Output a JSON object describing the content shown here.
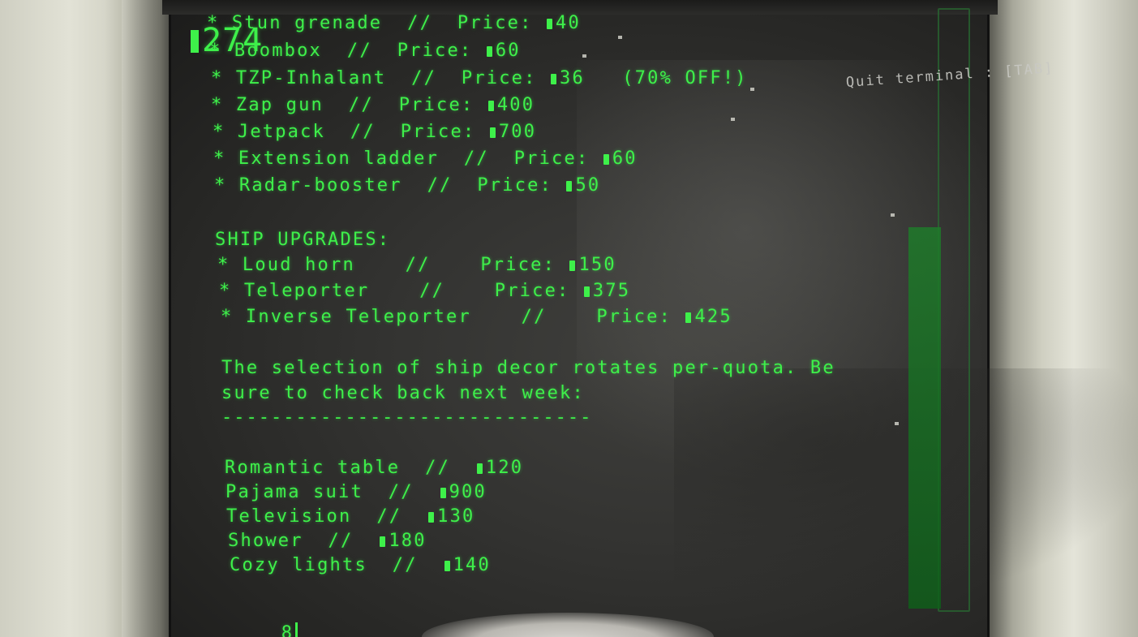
{
  "credits": "274",
  "quit_hint": "Quit terminal : [TAB]",
  "items": [
    {
      "name": "Stun grenade",
      "price": "40",
      "note": ""
    },
    {
      "name": "Boombox",
      "price": "60",
      "note": ""
    },
    {
      "name": "TZP-Inhalant",
      "price": "36",
      "note": "(70% OFF!)"
    },
    {
      "name": "Zap gun",
      "price": "400",
      "note": ""
    },
    {
      "name": "Jetpack",
      "price": "700",
      "note": ""
    },
    {
      "name": "Extension ladder",
      "price": "60",
      "note": ""
    },
    {
      "name": "Radar-booster",
      "price": "50",
      "note": ""
    }
  ],
  "upgrades_heading": "SHIP UPGRADES:",
  "upgrades": [
    {
      "name": "Loud horn",
      "price": "150"
    },
    {
      "name": "Teleporter",
      "price": "375"
    },
    {
      "name": "Inverse Teleporter",
      "price": "425"
    }
  ],
  "decor_note_line1": "The selection of ship decor rotates per-quota. Be",
  "decor_note_line2": "sure to check back next week:",
  "divider": "------------------------------",
  "decor": [
    {
      "name": "Romantic table",
      "price": "120"
    },
    {
      "name": "Pajama suit",
      "price": "900"
    },
    {
      "name": "Television",
      "price": "130"
    },
    {
      "name": "Shower",
      "price": "180"
    },
    {
      "name": "Cozy lights",
      "price": "140"
    }
  ],
  "input_value": "8",
  "labels": {
    "price": "Price:",
    "separator": "//",
    "bullet": "*"
  },
  "colors": {
    "terminal_green": "#3ef04a",
    "screen_bg": "#333331"
  }
}
